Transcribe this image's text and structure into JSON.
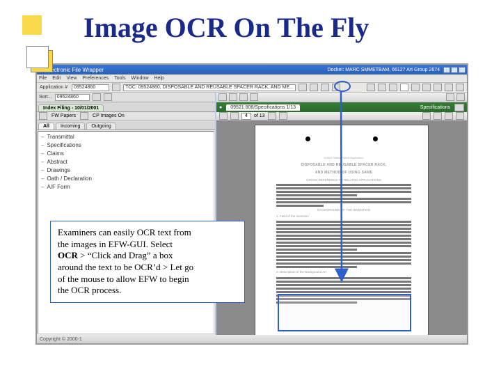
{
  "title": "Image OCR On The Fly",
  "window": {
    "title": "Electronic File Wrapper",
    "right_caption": "Docket: MARC SMMETBAM, 66127  Art Group 2674",
    "menus": [
      "File",
      "Edit",
      "View",
      "Preferences",
      "Tools",
      "Window",
      "Help"
    ],
    "app_label": "Application #",
    "app_value": "09524860",
    "toc_label": "TOC: 09524860, DISPOSABLE AND REUSABLE SPACER RACK, AND ME...",
    "status": "Copyright © 2000-1"
  },
  "left": {
    "sort_label": "Sort...",
    "sort_value": "09524860",
    "primary_tab": "Index Filing - 10/01/2001",
    "tabs": [
      "All",
      "Incoming",
      "Outgoing"
    ],
    "sub_bar": [
      "FW Papers",
      "CP Images On"
    ],
    "items": [
      "Transmittal",
      "Specifications",
      "Claims",
      "Abstract",
      "Drawings",
      "Oath / Declaration",
      "A/F Form"
    ]
  },
  "right": {
    "green_tabs_left": "",
    "green_tab_active": "09521 808/Specifications 1/13",
    "green_right": "Specifications",
    "page_field": "4",
    "page_of": "of 13",
    "doc": {
      "heading1": "DISPOSABLE AND REUSABLE SPACER RACK,",
      "heading2": "AND METHOD OF USING SAME",
      "cross_ref": "CROSS-REFERENCE TO RELATED APPLICATIONS",
      "background": "BACKGROUND OF THE INVENTION",
      "field": "1. Field of the Invention",
      "desc": "2. Description of the Background Art"
    }
  },
  "callout": {
    "line1": "Examiners can easily OCR text from",
    "line2": "the images in EFW-GUI.  Select",
    "line3a": "OCR",
    "line3b": " > “Click and Drag”  a box",
    "line4": "around the text to be OCR’d > Let go",
    "line5": "of the mouse to allow EFW to begin",
    "line6": "the OCR process."
  }
}
